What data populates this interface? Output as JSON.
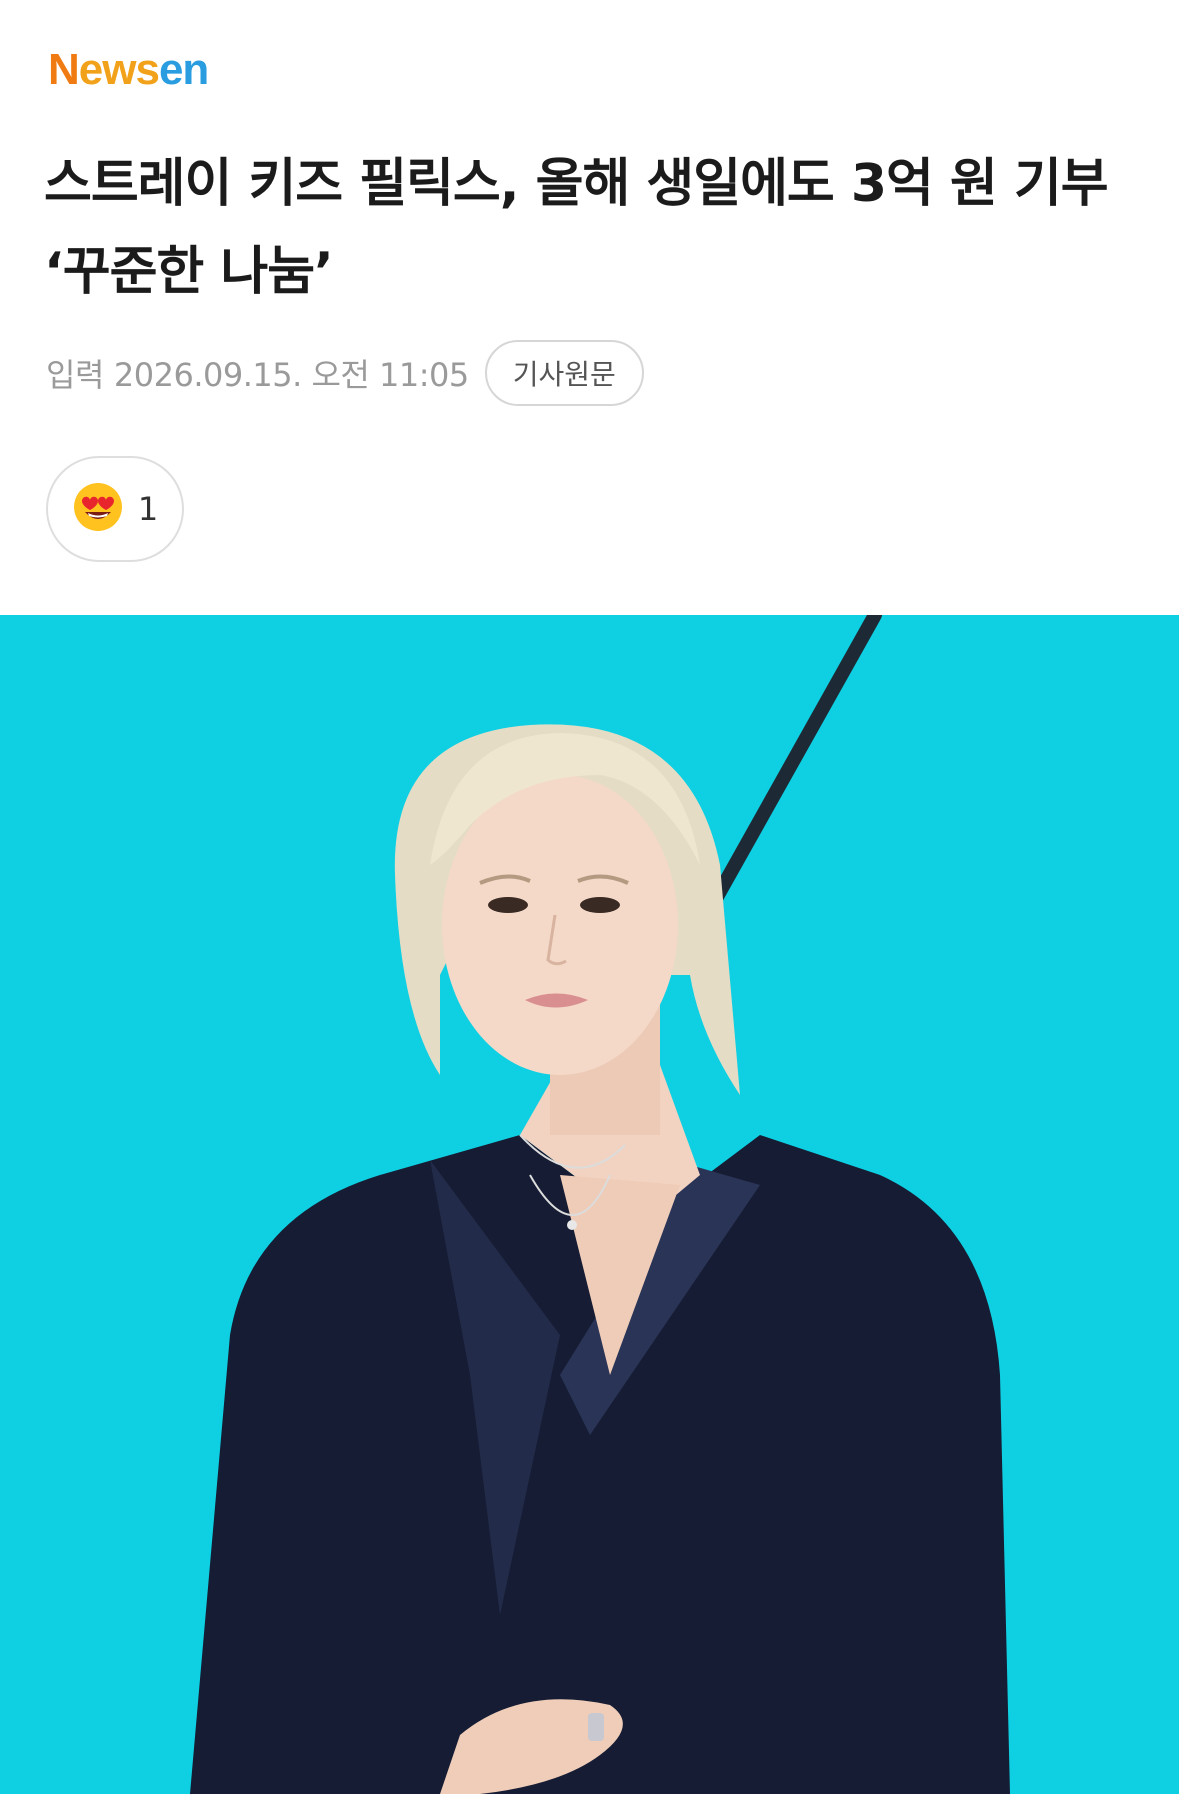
{
  "brand": {
    "logo_part1": "N",
    "logo_part2": "ews",
    "logo_part3": "en",
    "colors": {
      "orange": "#ef7b12",
      "amber": "#f2a21a",
      "blue": "#2a9de0"
    }
  },
  "article": {
    "headline": "스트레이 키즈 필릭스, 올해 생일에도 3억 원 기부 ‘꾸준한 나눔’",
    "meta_label": "입력",
    "date": "2026.09.15. 오전 11:05",
    "source_button": "기사원문"
  },
  "reaction": {
    "icon": "heart-eyes-emoji-icon",
    "count": "1"
  },
  "photo": {
    "background_color": "#0fd0e2",
    "subject": "person-with-blonde-hair-in-black-suit"
  }
}
